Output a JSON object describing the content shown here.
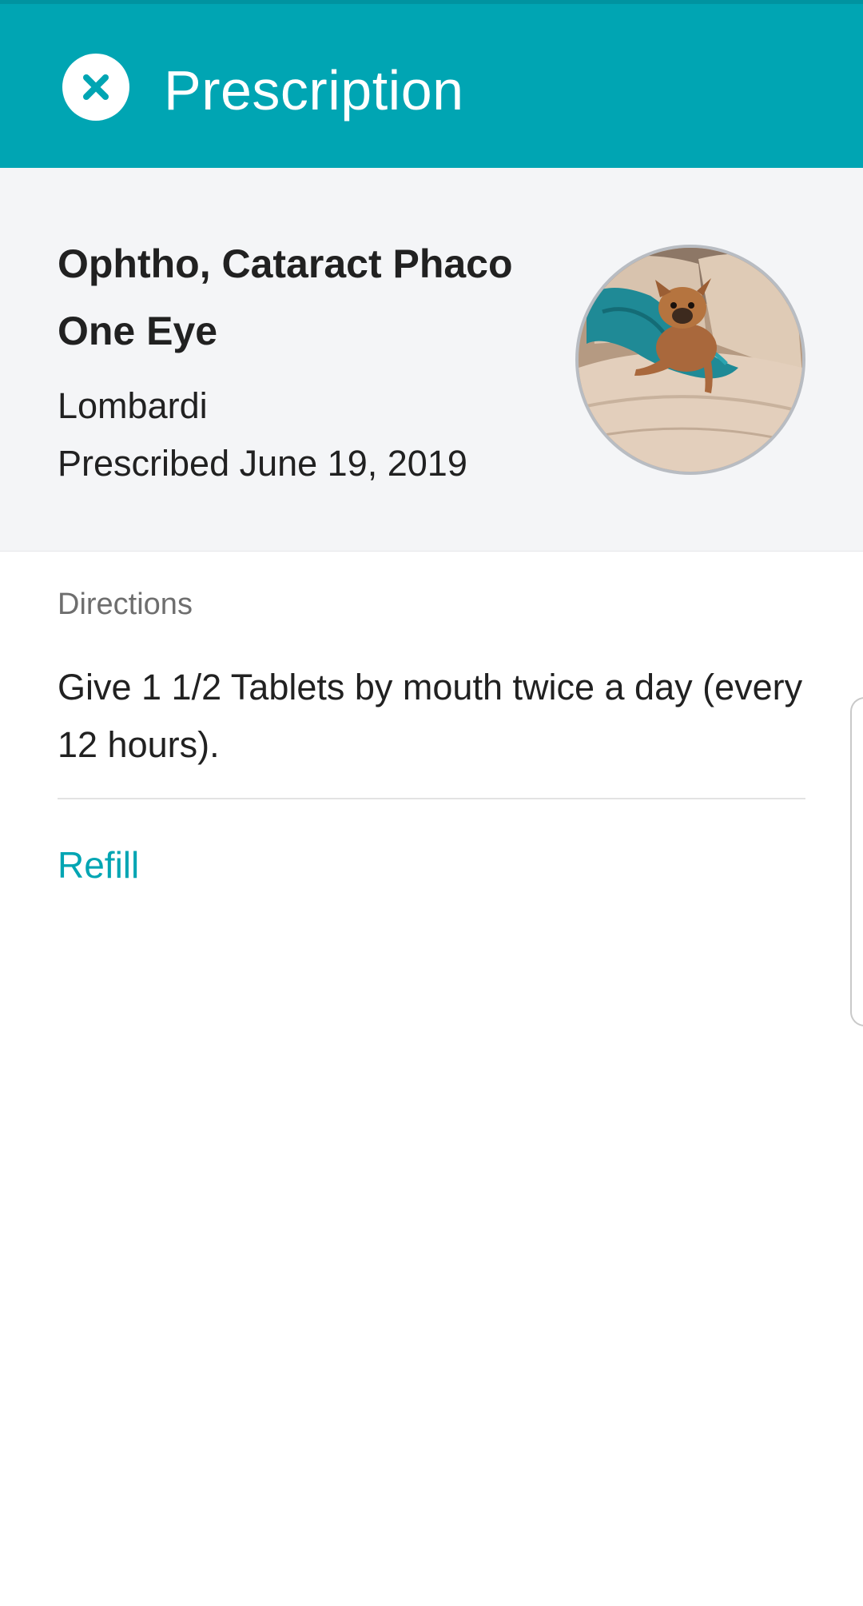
{
  "header": {
    "title": "Prescription",
    "close_icon": "close-icon",
    "background_color": "#00a5b3"
  },
  "summary": {
    "procedure": "Ophtho, Cataract Phaco One Eye",
    "doctor": "Lombardi",
    "prescribed": "Prescribed June 19, 2019",
    "photo_icon": "pet-photo"
  },
  "details": {
    "directions_label": "Directions",
    "directions_text": "Give 1 1/2 Tablets by mouth twice a day (every 12 hours).",
    "refill_label": "Refill",
    "accent_color": "#00a5b3"
  }
}
